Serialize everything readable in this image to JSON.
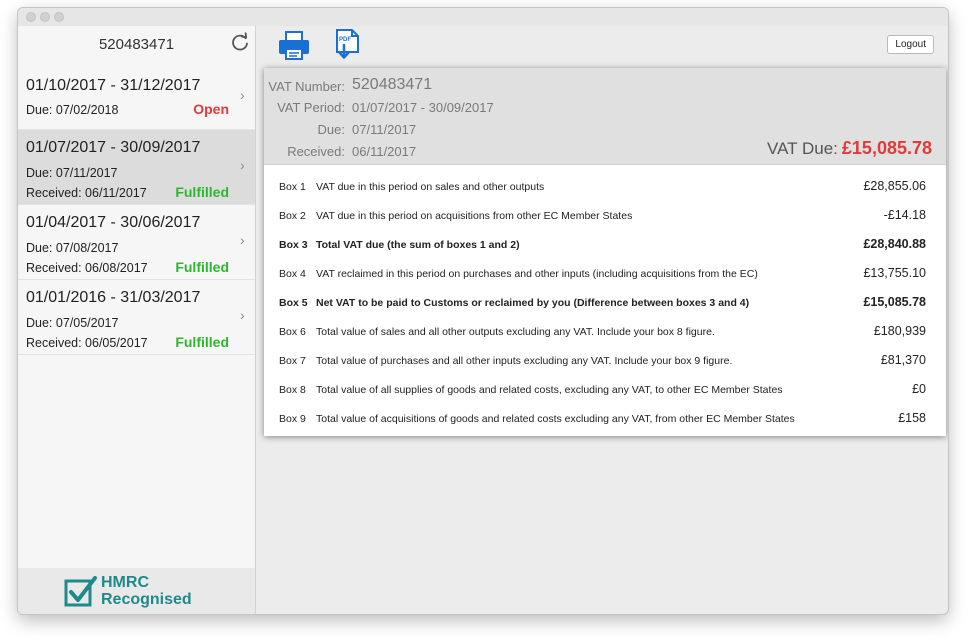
{
  "sidebar": {
    "vat_number": "520483471",
    "periods": [
      {
        "range": "01/10/2017 - 31/12/2017",
        "due": "Due: 07/02/2018",
        "received": "",
        "status": "Open",
        "status_color": "#e03a3a"
      },
      {
        "range": "01/07/2017 - 30/09/2017",
        "due": "Due: 07/11/2017",
        "received": "Received: 06/11/2017",
        "status": "Fulfilled",
        "status_color": "#2fb52f"
      },
      {
        "range": "01/04/2017 - 30/06/2017",
        "due": "Due: 07/08/2017",
        "received": "Received: 06/08/2017",
        "status": "Fulfilled",
        "status_color": "#2fb52f"
      },
      {
        "range": "01/01/2016 - 31/03/2017",
        "due": "Due: 07/05/2017",
        "received": "Received: 06/05/2017",
        "status": "Fulfilled",
        "status_color": "#2fb52f"
      }
    ],
    "footer": {
      "line1": "HMRC",
      "line2": "Recognised"
    }
  },
  "toolbar": {
    "logout_label": "Logout",
    "print_icon": "printer-icon",
    "pdf_icon": "pdf-download-icon"
  },
  "detail": {
    "vat_number_label": "VAT Number:",
    "vat_number_value": "520483471",
    "period_label": "VAT Period:",
    "period_value": "01/07/2017 - 30/09/2017",
    "due_label": "Due:",
    "due_value": "07/11/2017",
    "received_label": "Received:",
    "received_value": "06/11/2017",
    "vat_due_label": "VAT Due:",
    "vat_due_value": "£15,085.78",
    "boxes": [
      {
        "id": "Box 1",
        "desc": "VAT due in this period on sales and other outputs",
        "amount": "£28,855.06",
        "bold": false
      },
      {
        "id": "Box 2",
        "desc": "VAT due in this period on acquisitions from other EC Member States",
        "amount": "-£14.18",
        "bold": false
      },
      {
        "id": "Box 3",
        "desc": "Total VAT due (the sum of boxes 1 and 2)",
        "amount": "£28,840.88",
        "bold": true
      },
      {
        "id": "Box 4",
        "desc": "VAT reclaimed in this period on purchases and other inputs (including acquisitions from the EC)",
        "amount": "£13,755.10",
        "bold": false
      },
      {
        "id": "Box 5",
        "desc": "Net VAT to be paid to Customs or reclaimed by you (Difference between boxes 3 and 4)",
        "amount": "£15,085.78",
        "bold": true
      },
      {
        "id": "Box 6",
        "desc": "Total value of sales and all other outputs excluding any VAT. Include your box 8 figure.",
        "amount": "£180,939",
        "bold": false
      },
      {
        "id": "Box 7",
        "desc": "Total value of purchases and all other inputs excluding any VAT. Include your box 9 figure.",
        "amount": "£81,370",
        "bold": false
      },
      {
        "id": "Box 8",
        "desc": "Total value of all supplies of goods and related costs, excluding any VAT, to other EC Member States",
        "amount": "£0",
        "bold": false
      },
      {
        "id": "Box 9",
        "desc": "Total value of acquisitions of goods and related costs excluding any VAT, from other EC Member States",
        "amount": "£158",
        "bold": false
      }
    ]
  },
  "colors": {
    "accent": "#1a6fd4",
    "open": "#e03a3a",
    "fulfilled": "#2fb52f",
    "brand_teal": "#1e8a8a"
  }
}
